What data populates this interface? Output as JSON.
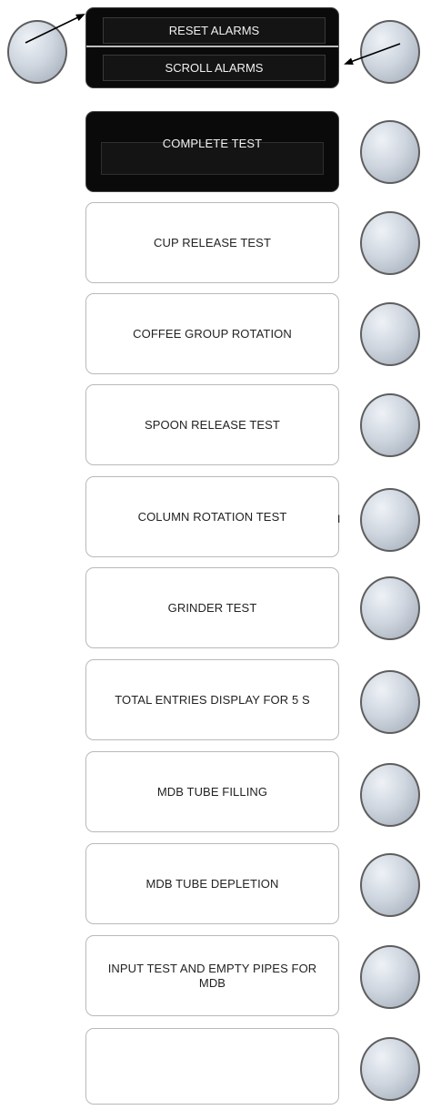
{
  "alarm_panel": {
    "reset_label": "RESET ALARMS",
    "scroll_label": "SCROLL ALARMS"
  },
  "tick_mark": "I",
  "panels": [
    {
      "label": "COMPLETE TEST",
      "style": "dark"
    },
    {
      "label": "CUP RELEASE TEST",
      "style": "light"
    },
    {
      "label": "COFFEE GROUP ROTATION",
      "style": "light"
    },
    {
      "label": "SPOON RELEASE TEST",
      "style": "light"
    },
    {
      "label": "COLUMN ROTATION TEST",
      "style": "light"
    },
    {
      "label": "GRINDER TEST",
      "style": "light"
    },
    {
      "label": "TOTAL ENTRIES DISPLAY FOR 5 S",
      "style": "light"
    },
    {
      "label": "MDB TUBE FILLING",
      "style": "light"
    },
    {
      "label": "MDB TUBE DEPLETION",
      "style": "light"
    },
    {
      "label": "INPUT TEST AND EMPTY PIPES FOR MDB",
      "style": "light"
    },
    {
      "label": "",
      "style": "light"
    }
  ],
  "colors": {
    "button_fill": "#cfd6df",
    "button_border": "#5e5e5e",
    "dark_panel": "#0a0a0a",
    "panel_border": "#b9b9b9"
  }
}
